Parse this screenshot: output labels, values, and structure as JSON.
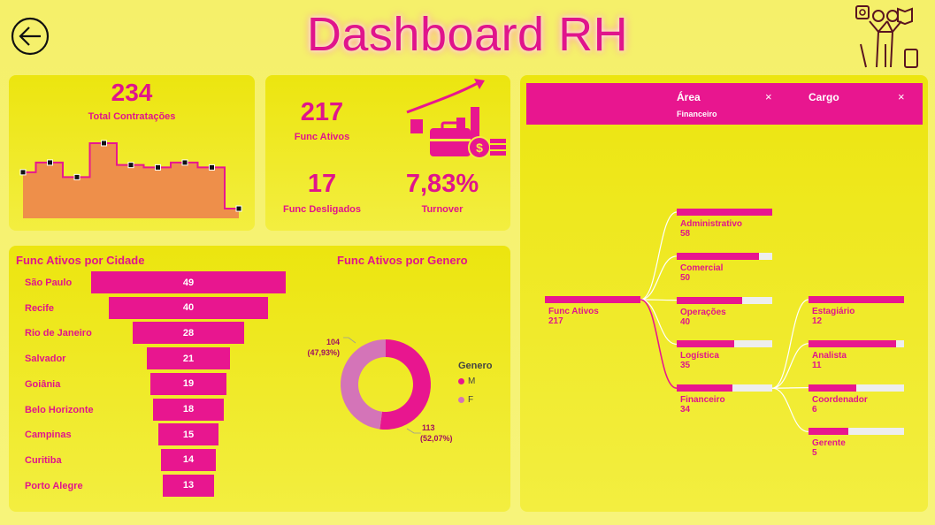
{
  "header": {
    "title": "Dashboard RH"
  },
  "kpis": {
    "total_contratacoes": {
      "value": "234",
      "label": "Total Contratações"
    },
    "func_ativos": {
      "value": "217",
      "label": "Func Ativos"
    },
    "func_desligados": {
      "value": "17",
      "label": "Func Desligados"
    },
    "turnover": {
      "value": "7,83%",
      "label": "Turnover"
    }
  },
  "colors": {
    "accent": "#e8168f",
    "area_fill": "#ee8f4a",
    "female": "#d474b8",
    "background": "#f5f06a"
  },
  "chart_data": [
    {
      "type": "area",
      "title": "",
      "values": [
        19,
        23,
        17,
        31,
        22,
        21,
        23,
        21,
        4
      ],
      "ylim": [
        0,
        35
      ]
    },
    {
      "type": "bar",
      "title": "Func Ativos por Cidade",
      "categories": [
        "São Paulo",
        "Recife",
        "Rio de Janeiro",
        "Salvador",
        "Goiânia",
        "Belo Horizonte",
        "Campinas",
        "Curitiba",
        "Porto Alegre"
      ],
      "values": [
        49,
        40,
        28,
        21,
        19,
        18,
        15,
        14,
        13
      ]
    },
    {
      "type": "pie",
      "title": "Func Ativos por Genero",
      "legend_title": "Genero",
      "categories": [
        "M",
        "F"
      ],
      "values": [
        113,
        104
      ],
      "labels": [
        [
          "113",
          "(52,07%)"
        ],
        [
          "104",
          "(47,93%)"
        ]
      ],
      "legend_position": "right"
    }
  ],
  "tree": {
    "columns": [
      {
        "title": "Área",
        "subtitle": "Financeiro"
      },
      {
        "title": "Cargo",
        "subtitle": ""
      }
    ],
    "close_glyph": "×",
    "root": {
      "label": "Func Ativos",
      "value": "217"
    },
    "areas": [
      {
        "label": "Administrativo",
        "value": 58
      },
      {
        "label": "Comercial",
        "value": 50
      },
      {
        "label": "Operações",
        "value": 40
      },
      {
        "label": "Logística",
        "value": 35
      },
      {
        "label": "Financeiro",
        "value": 34
      }
    ],
    "cargos": [
      {
        "label": "Estagiário",
        "value": 12
      },
      {
        "label": "Analista",
        "value": 11
      },
      {
        "label": "Coordenador",
        "value": 6
      },
      {
        "label": "Gerente",
        "value": 5
      }
    ]
  }
}
